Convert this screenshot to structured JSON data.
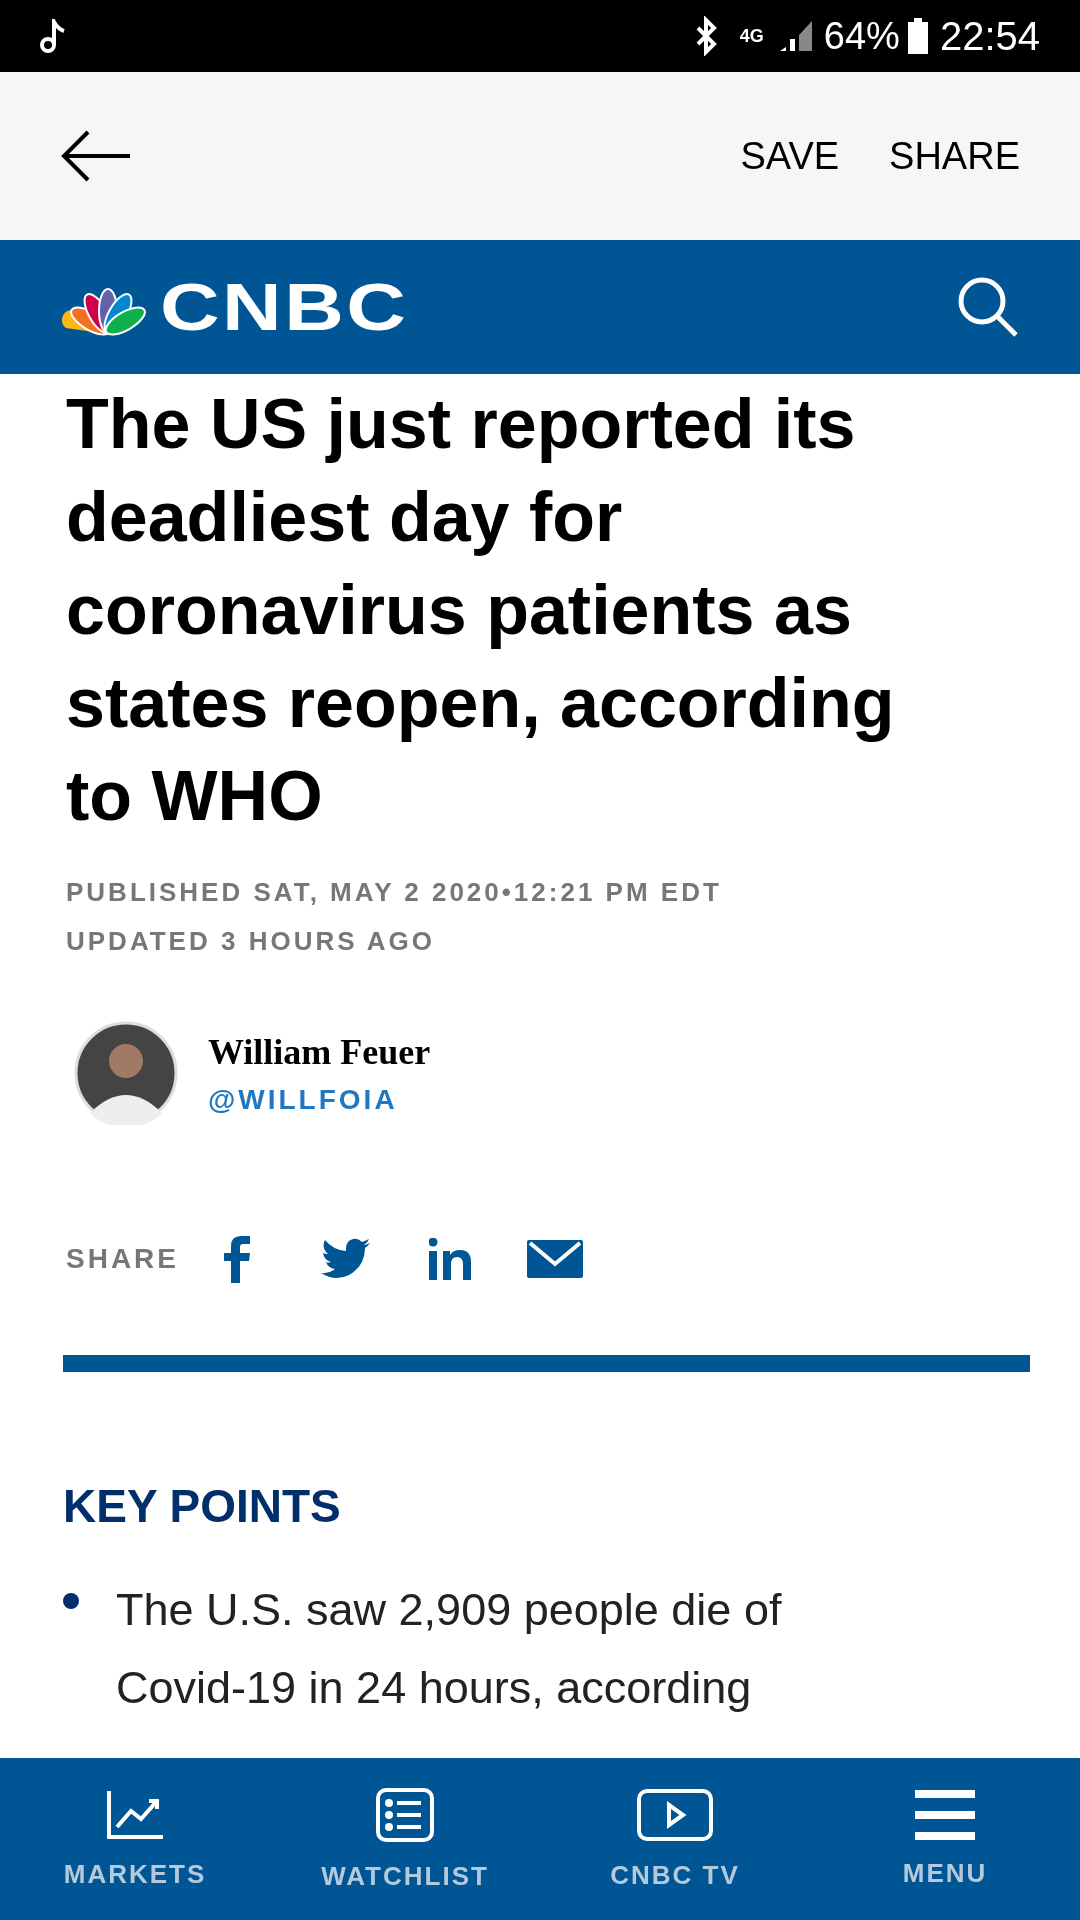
{
  "status_bar": {
    "time": "22:54",
    "battery": "64%",
    "network": "4G"
  },
  "toolbar": {
    "actions": [
      "SAVE",
      "SHARE"
    ]
  },
  "header": {
    "logo": "CNBC"
  },
  "article": {
    "headline": "The US just reported its deadliest day for coronavirus patients as states reopen, according to WHO",
    "published": "PUBLISHED SAT, MAY 2 2020•12:21 PM EDT",
    "updated": "UPDATED 3 HOURS AGO",
    "author": {
      "name": "William Feuer",
      "handle": "@WILLFOIA"
    },
    "share_label": "SHARE",
    "key_points_title": "KEY POINTS",
    "key_points": [
      "The U.S. saw 2,909 people die of Covid-19 in 24 hours, according"
    ]
  },
  "bottom_nav": [
    {
      "label": "MARKETS",
      "kind": "chart"
    },
    {
      "label": "WATCHLIST",
      "kind": "list"
    },
    {
      "label": "CNBC TV",
      "kind": "tv"
    },
    {
      "label": "MENU",
      "kind": "menu"
    }
  ]
}
